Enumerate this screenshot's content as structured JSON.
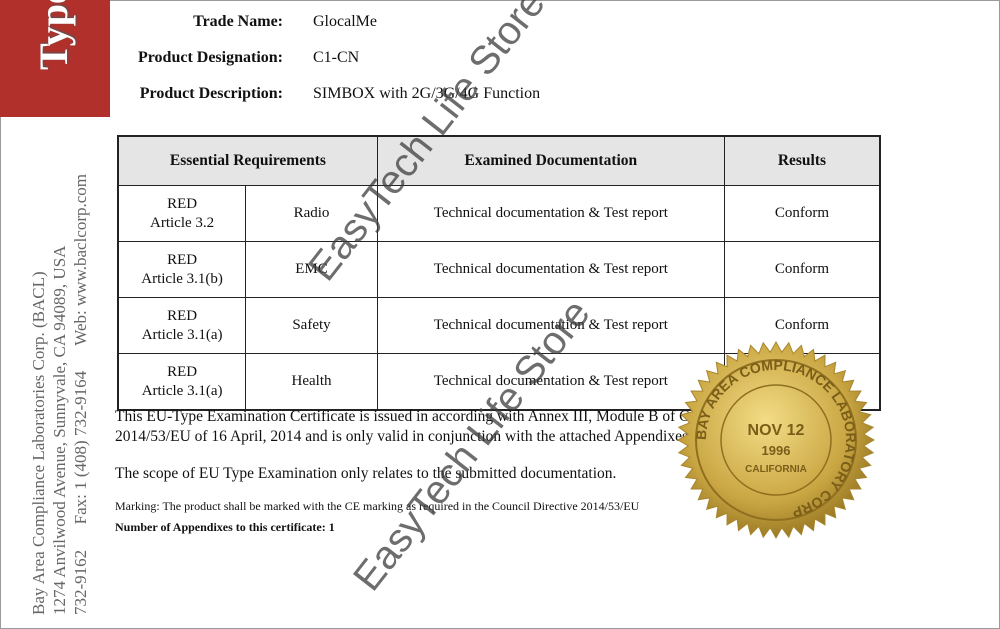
{
  "header": {
    "type_label": "Type"
  },
  "side": {
    "company": "Bay Area Compliance Laboratories Corp. (BACL)",
    "address": "1274 Anvilwood Avenue, Sunnyvale, CA 94089, USA",
    "contact": "732-9162      Fax: 1 (408) 732-9164      Web: www.baclcorp.com"
  },
  "fields": [
    {
      "label": "Trade Name:",
      "value": "GlocalMe"
    },
    {
      "label": "Product Designation:",
      "value": "C1-CN"
    },
    {
      "label": "Product Description:",
      "value": "SIMBOX with 2G/3G/4G Function"
    }
  ],
  "table": {
    "headers": [
      "Essential Requirements",
      "Examined Documentation",
      "Results"
    ],
    "rows": [
      {
        "req1": "RED",
        "req2": "Article 3.2",
        "area": "Radio",
        "doc": "Technical documentation & Test report",
        "result": "Conform"
      },
      {
        "req1": "RED",
        "req2": "Article 3.1(b)",
        "area": "EMC",
        "doc": "Technical documentation & Test report",
        "result": "Conform"
      },
      {
        "req1": "RED",
        "req2": "Article 3.1(a)",
        "area": "Safety",
        "doc": "Technical documentation & Test report",
        "result": "Conform"
      },
      {
        "req1": "RED",
        "req2": "Article 3.1(a)",
        "area": "Health",
        "doc": "Technical documentation & Test report",
        "result": "Conform"
      }
    ]
  },
  "body": {
    "para1_line1": "This EU-Type Examination Certificate is issued in according with Annex III, Module B of Council Directive",
    "para1_line2": "2014/53/EU of 16 April, 2014 and is only valid in conjunction with the attached Appendixes.",
    "para2": "The scope of EU Type Examination only relates to the submitted documentation.",
    "marking": "Marking: The product shall be marked with the CE marking as required in the Council Directive 2014/53/EU",
    "appendixes": "Number of Appendixes to this certificate: 1"
  },
  "watermark": "EasyTech Life Store",
  "seal": {
    "ring": "BAY AREA COMPLIANCE LABORATORY CORP",
    "date": "NOV 12",
    "year": "1996",
    "state": "CALIFORNIA",
    "color": "#c9a642"
  },
  "colors": {
    "brand_red": "#b1302b",
    "header_gray": "#e5e5e5"
  }
}
